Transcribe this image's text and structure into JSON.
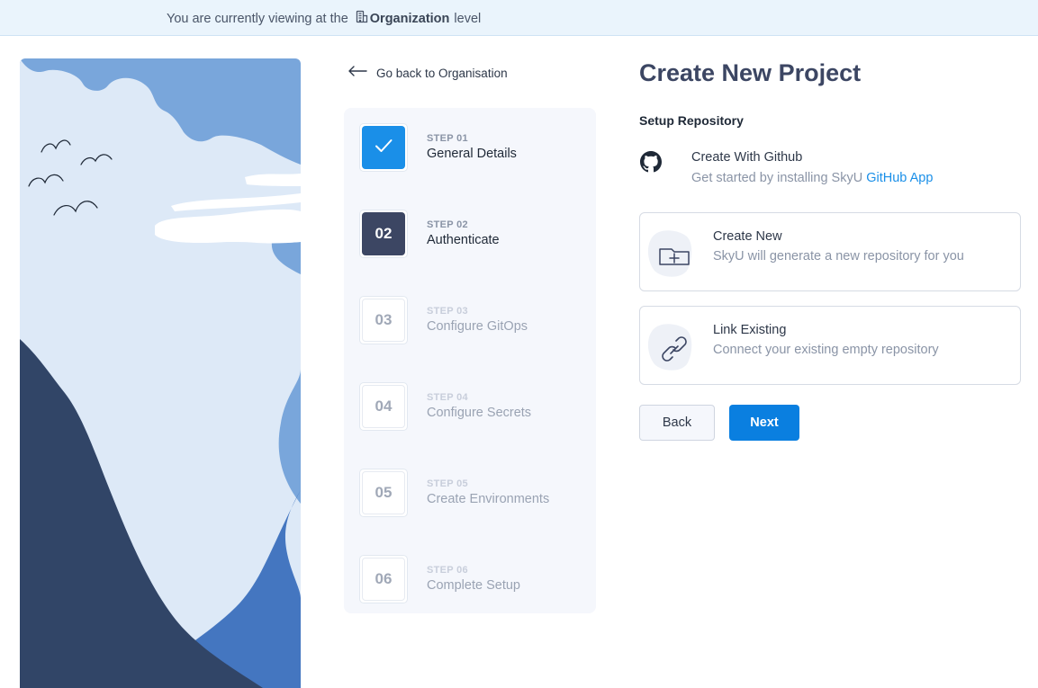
{
  "banner": {
    "prefix": "You are currently viewing at the",
    "level": "Organization",
    "suffix": "level",
    "icon": "building-icon"
  },
  "illustration": {
    "colors": {
      "sky": "#79a6db",
      "cloud": "#dde9f7",
      "mountain_dark": "#314567",
      "mountain_mid": "#4476c0"
    }
  },
  "nav": {
    "back_label": "Go back to Organisation",
    "icon": "arrow-left-icon"
  },
  "steps": [
    {
      "number": "01",
      "kicker": "STEP 01",
      "label": "General Details",
      "status": "done"
    },
    {
      "number": "02",
      "kicker": "STEP 02",
      "label": "Authenticate",
      "status": "active"
    },
    {
      "number": "03",
      "kicker": "STEP 03",
      "label": "Configure GitOps",
      "status": "pending"
    },
    {
      "number": "04",
      "kicker": "STEP 04",
      "label": "Configure Secrets",
      "status": "pending"
    },
    {
      "number": "05",
      "kicker": "STEP 05",
      "label": "Create Environments",
      "status": "pending"
    },
    {
      "number": "06",
      "kicker": "STEP 06",
      "label": "Complete Setup",
      "status": "pending"
    }
  ],
  "main": {
    "title": "Create New Project",
    "subtitle": "Setup Repository",
    "github": {
      "title": "Create With Github",
      "desc_prefix": "Get started by installing SkyU",
      "link_text": "GitHub App",
      "icon": "github-icon"
    },
    "options": [
      {
        "title": "Create New",
        "desc": "SkyU will generate a new repository for you",
        "icon": "folder-plus-icon"
      },
      {
        "title": "Link Existing",
        "desc": "Connect your existing empty repository",
        "icon": "link-icon"
      }
    ],
    "buttons": {
      "back": "Back",
      "next": "Next"
    }
  },
  "colors": {
    "accent": "#0a7fe0",
    "active_step": "#3c4663",
    "done_step": "#1a8fe8",
    "banner_bg": "#eaf4fc"
  }
}
